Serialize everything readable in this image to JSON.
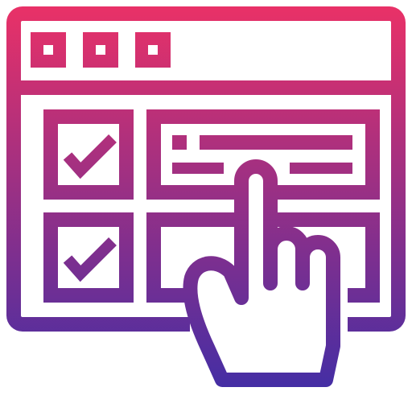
{
  "icon": {
    "name": "checklist-form-hand-icon",
    "gradient": {
      "top": "#ec3166",
      "bottom": "#3a2ea8"
    },
    "background": "#ffffff",
    "window_buttons": [
      "window-button-icon",
      "window-button-icon",
      "window-button-icon"
    ],
    "rows": [
      {
        "checkbox": "checked",
        "field": "text-lines"
      },
      {
        "checkbox": "checked",
        "field": "empty"
      }
    ],
    "pointer": "pointing-hand-icon"
  }
}
